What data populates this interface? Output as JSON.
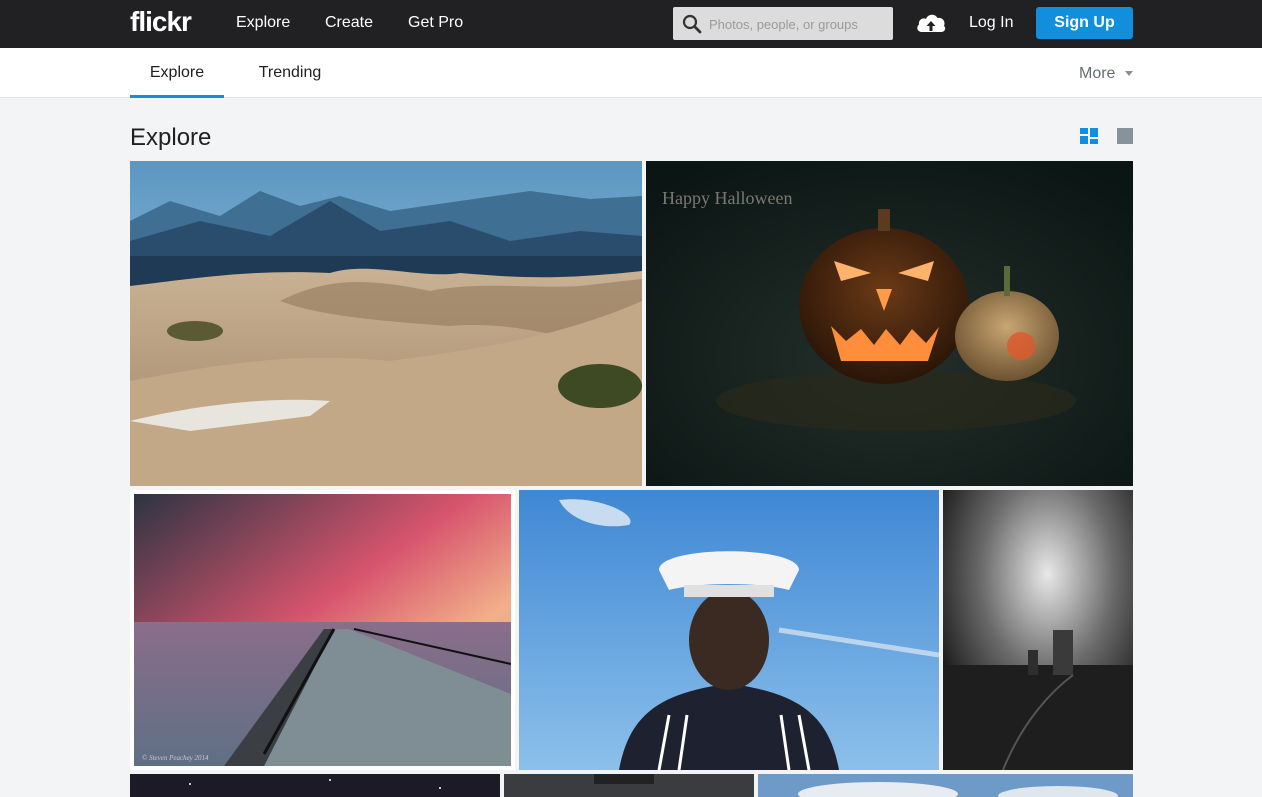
{
  "header": {
    "logo": "flickr",
    "nav": [
      "Explore",
      "Create",
      "Get Pro"
    ],
    "search_placeholder": "Photos, people, or groups",
    "login_label": "Log In",
    "signup_label": "Sign Up",
    "accent_color": "#128fdc",
    "icons": [
      "search-icon",
      "upload-cloud-icon"
    ]
  },
  "subnav": {
    "tabs": [
      "Explore",
      "Trending"
    ],
    "active_tab": "Explore",
    "more_label": "More"
  },
  "page": {
    "title": "Explore",
    "view_toggle_icons": [
      "justified-grid-view-icon",
      "single-view-icon"
    ]
  },
  "photos": [
    {
      "subject": "desert-sand-dunes"
    },
    {
      "subject": "halloween-pumpkins",
      "overlay_text": "Happy Halloween"
    },
    {
      "subject": "pier-sunset",
      "watermark": "© Steven Peachey 2014"
    },
    {
      "subject": "sailor-blue-angels"
    },
    {
      "subject": "bw-storm-ruins"
    },
    {
      "subject": "night-sky"
    },
    {
      "subject": "dark-cloud"
    },
    {
      "subject": "blue-sky-clouds"
    }
  ]
}
